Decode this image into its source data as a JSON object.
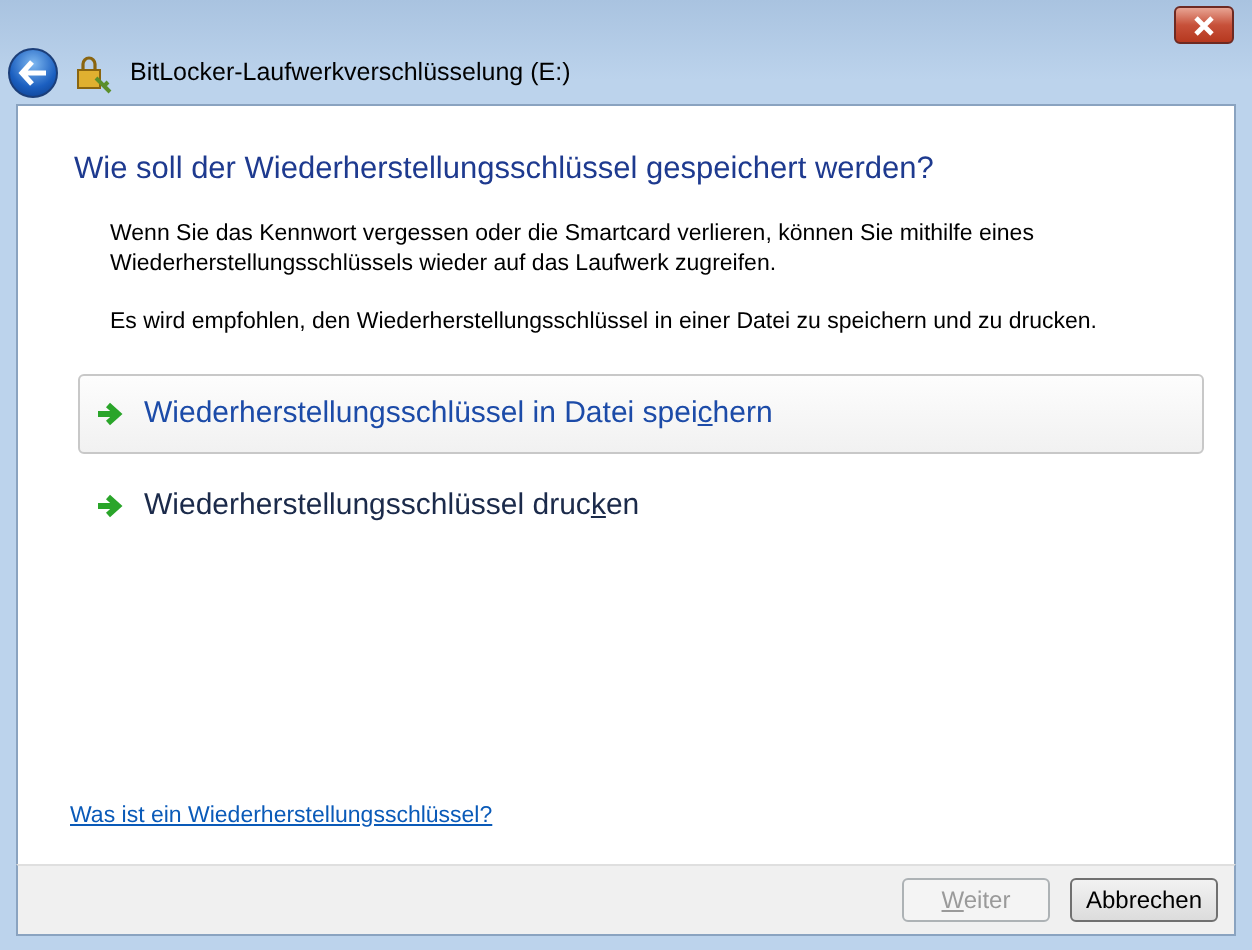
{
  "window": {
    "title": "BitLocker-Laufwerkverschlüsselung (E:)"
  },
  "heading": "Wie soll der Wiederherstellungsschlüssel gespeichert werden?",
  "paragraphs": [
    "Wenn Sie das Kennwort vergessen oder die Smartcard verlieren, können Sie mithilfe eines Wiederherstellungsschlüssels wieder auf das Laufwerk zugreifen.",
    "Es wird empfohlen, den Wiederherstellungsschlüssel in einer Datei zu speichern und zu drucken."
  ],
  "options": [
    {
      "label": {
        "before": "Wiederherstellungsschlüssel in Datei spei",
        "access_key": "c",
        "after": "hern"
      },
      "selected": true
    },
    {
      "label": {
        "before": "Wiederherstellungsschlüssel druc",
        "access_key": "k",
        "after": "en"
      },
      "selected": false
    }
  ],
  "help_link": "Was ist ein Wiederherstellungsschlüssel?",
  "buttons": [
    {
      "label": {
        "access_key": "W",
        "after": "eiter"
      },
      "disabled": true
    },
    {
      "label": {
        "before": "Abbrechen"
      },
      "disabled": false
    }
  ]
}
